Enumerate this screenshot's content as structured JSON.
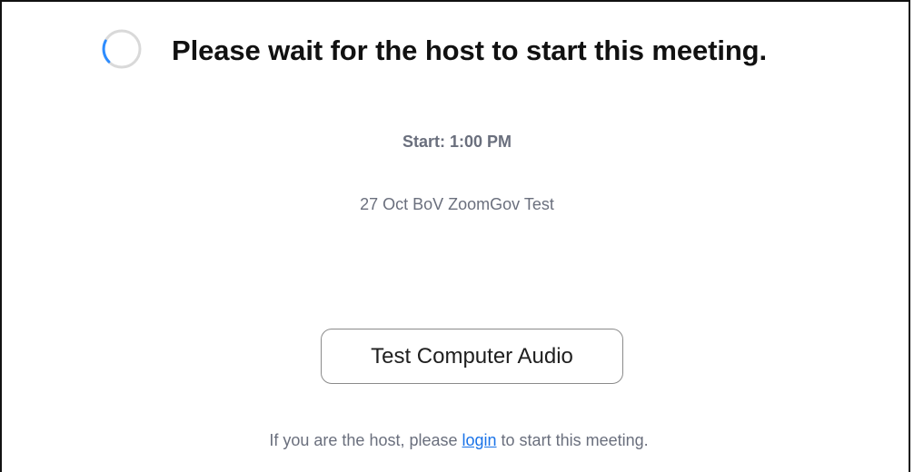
{
  "waiting": {
    "title": "Please wait for the host to start this meeting.",
    "spinner_icon": "loading-spinner-icon"
  },
  "meeting": {
    "start_time": "Start: 1:00 PM",
    "topic": "27 Oct BoV ZoomGov Test"
  },
  "actions": {
    "test_audio_label": "Test Computer Audio"
  },
  "host_prompt": {
    "before_link": "If you are the host, please ",
    "link_label": "login",
    "after_link": " to start this meeting."
  },
  "colors": {
    "spinner_ring": "#d9d9d9",
    "spinner_arc": "#2d8cff",
    "link": "#1a73e8",
    "muted_text": "#6a6f7d"
  }
}
